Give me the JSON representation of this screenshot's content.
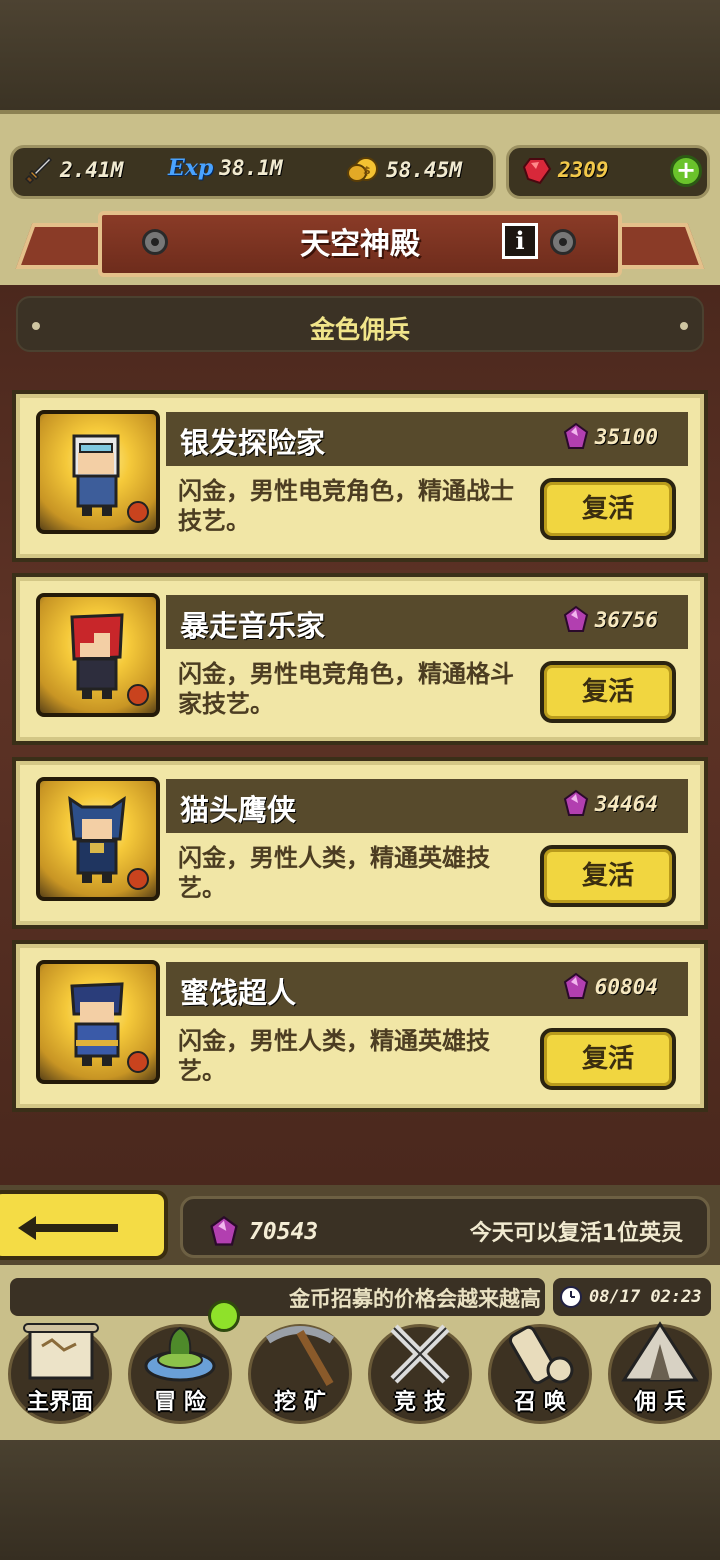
{
  "resources": {
    "attack": "2.41M",
    "exp_icon_label": "Exp",
    "exp": "38.1M",
    "gold": "58.45M",
    "gems": "2309",
    "add_label": "+"
  },
  "header": {
    "title": "天空神殿",
    "info_label": "i"
  },
  "subtitle": "金色佣兵",
  "heroes": [
    {
      "name": "银发探险家",
      "price": "35100",
      "desc": "闪金，男性电竞角色，精通战士技艺。",
      "action": "复活"
    },
    {
      "name": "暴走音乐家",
      "price": "36756",
      "desc": "闪金，男性电竞角色，精通格斗家技艺。",
      "action": "复活"
    },
    {
      "name": "猫头鹰侠",
      "price": "34464",
      "desc": "闪金，男性人类，精通英雄技艺。",
      "action": "复活"
    },
    {
      "name": "蜜饯超人",
      "price": "60804",
      "desc": "闪金，男性人类，精通英雄技艺。",
      "action": "复活"
    }
  ],
  "footer": {
    "crystal_count": "70543",
    "revive_note": "今天可以复活1位英灵"
  },
  "ticker": "金币招募的价格会越来越高",
  "clock": "08/17 02:23",
  "nav": [
    {
      "label": "主界面",
      "icon": "scroll-map-icon"
    },
    {
      "label": "冒 险",
      "icon": "island-icon"
    },
    {
      "label": "挖 矿",
      "icon": "pickaxe-icon"
    },
    {
      "label": "竞 技",
      "icon": "crossed-swords-icon"
    },
    {
      "label": "召 唤",
      "icon": "summon-scroll-icon"
    },
    {
      "label": "佣 兵",
      "icon": "tent-icon"
    }
  ],
  "colors": {
    "card_bg": "#f1e6a6",
    "revive_button": "#f1d640",
    "banner": "#8a3b27",
    "crystal": "#b23fb0"
  }
}
